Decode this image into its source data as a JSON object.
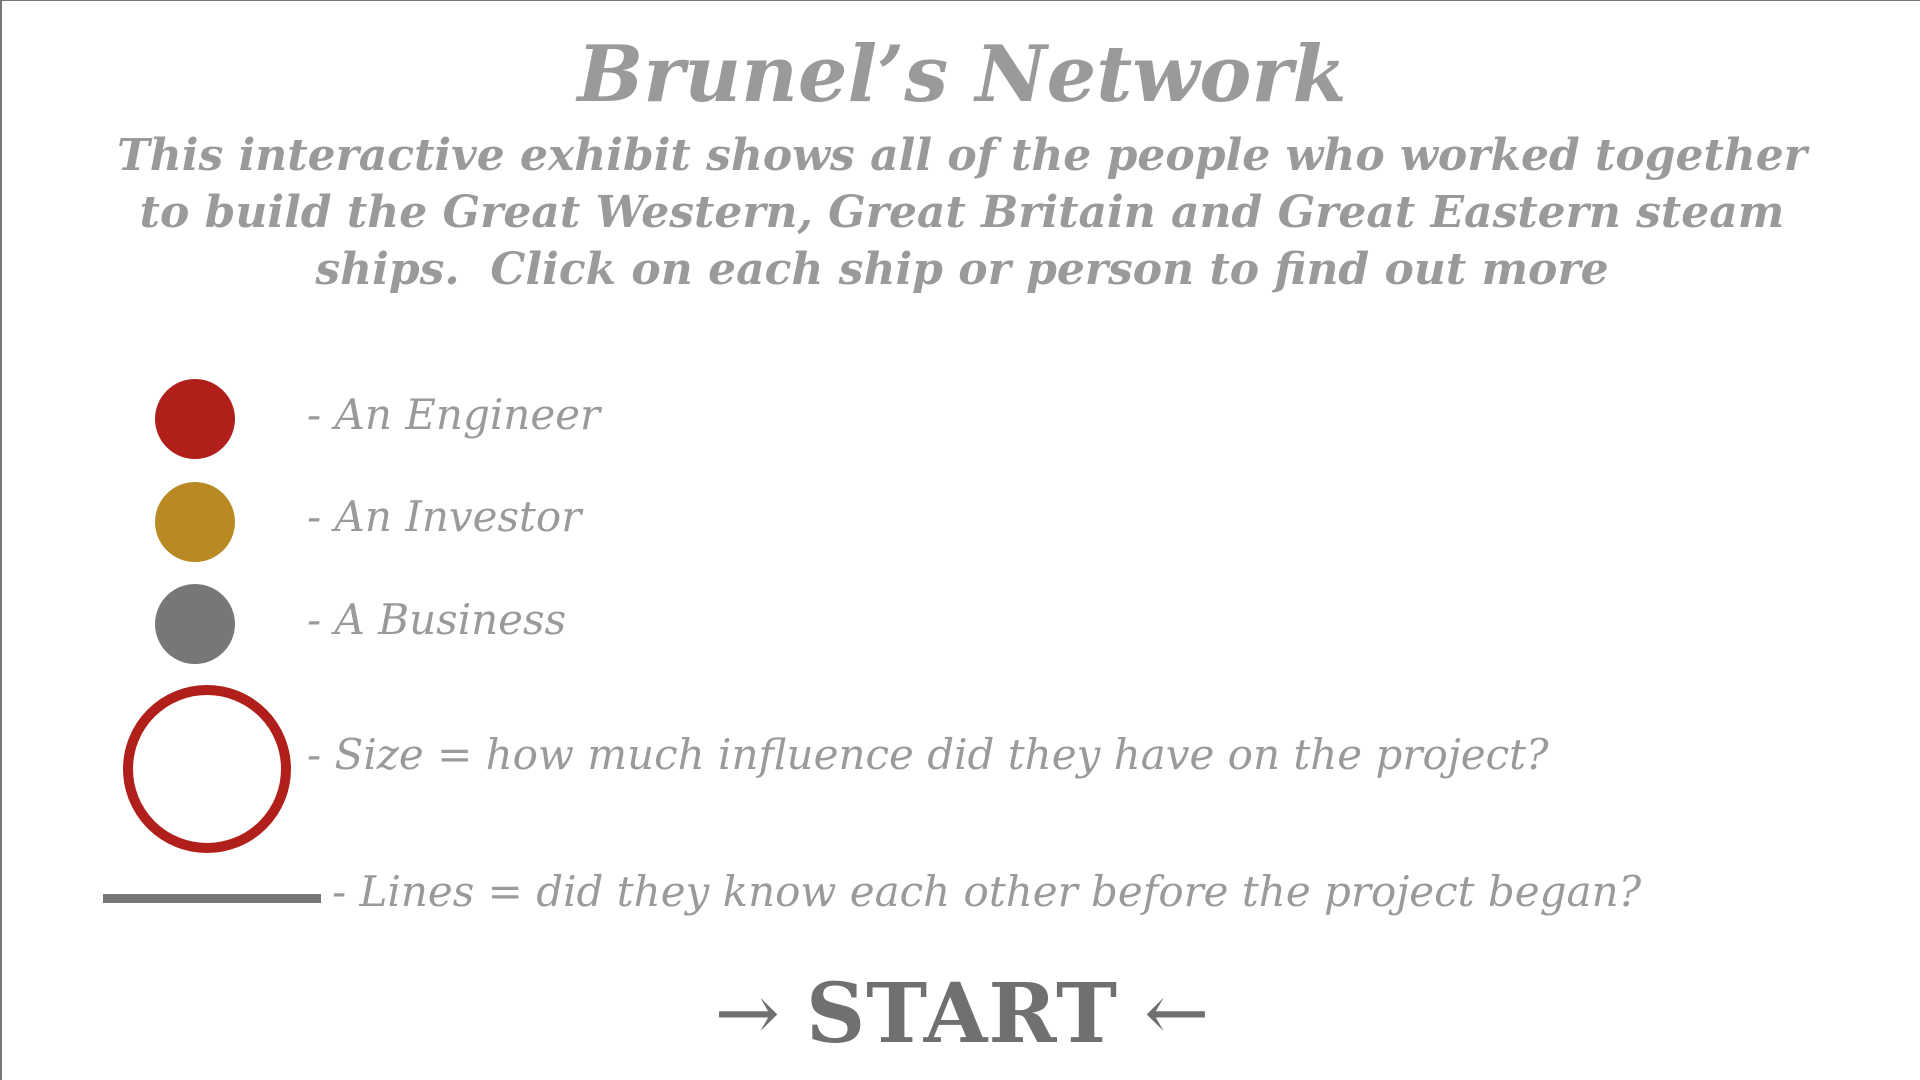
{
  "page": {
    "title": "Brunel’s Network",
    "intro_lines": [
      "This interactive exhibit shows all of the people who worked together",
      "to build the Great Western, Great Britain and Great Eastern steam",
      "ships.  Click on each ship or person to find out more"
    ]
  },
  "legend": {
    "items": [
      {
        "key": "engineer",
        "symbol": "filled-circle",
        "color": "#b01f1a",
        "label": "- An Engineer"
      },
      {
        "key": "investor",
        "symbol": "filled-circle",
        "color": "#b98a23",
        "label": "- An Investor"
      },
      {
        "key": "business",
        "symbol": "filled-circle",
        "color": "#777777",
        "label": "- A Business"
      },
      {
        "key": "size",
        "symbol": "ring",
        "color": "#b01f1a",
        "label": "- Size = how much influence did they have on the project?"
      },
      {
        "key": "lines",
        "symbol": "line",
        "color": "#777777",
        "label": "- Lines = did they know each other before the project began?"
      }
    ]
  },
  "start_button": {
    "left_arrow": "→",
    "label": "START",
    "right_arrow": "←"
  },
  "colors": {
    "text": "#9a9a9a",
    "start_text": "#707070",
    "engineer": "#b01f1a",
    "investor": "#b98a23",
    "business": "#777777"
  }
}
